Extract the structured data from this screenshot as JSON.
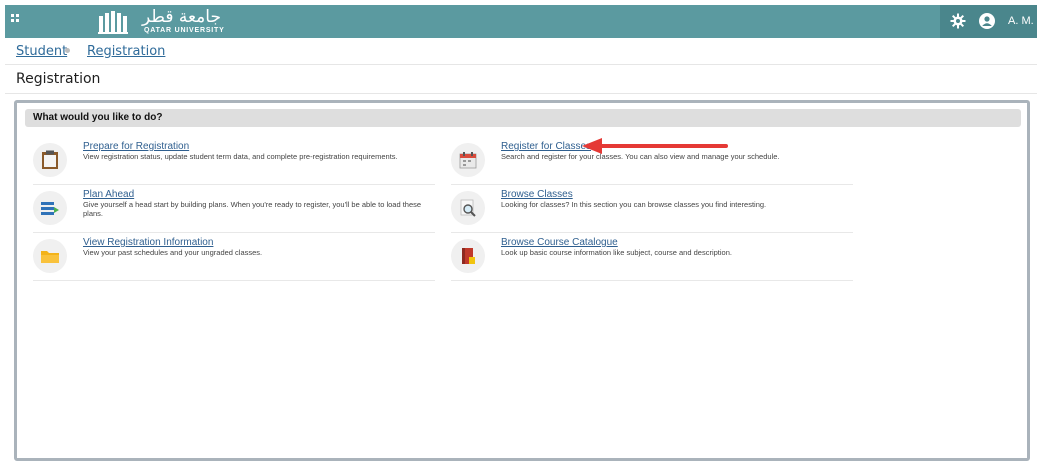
{
  "header": {
    "logo_arabic": "جامعة قطر",
    "logo_english": "QATAR UNIVERSITY",
    "user_name": "A. M."
  },
  "breadcrumb": {
    "items": [
      "Student",
      "Registration"
    ]
  },
  "page": {
    "title": "Registration"
  },
  "panel": {
    "heading": "What would you like to do?",
    "items": [
      {
        "title": "Prepare for Registration",
        "desc": "View registration status, update student term data, and complete pre-registration requirements.",
        "icon": "clipboard-icon"
      },
      {
        "title": "Register for Classes",
        "desc": "Search and register for your classes. You can also view and manage your schedule.",
        "icon": "calendar-icon"
      },
      {
        "title": "Plan Ahead",
        "desc": "Give yourself a head start by building plans. When you're ready to register, you'll be able to load these plans.",
        "icon": "plan-list-icon"
      },
      {
        "title": "Browse Classes",
        "desc": "Looking for classes? In this section you can browse classes you find interesting.",
        "icon": "magnifier-icon"
      },
      {
        "title": "View Registration Information",
        "desc": "View your past schedules and your ungraded classes.",
        "icon": "folder-icon"
      },
      {
        "title": "Browse Course Catalogue",
        "desc": "Look up basic course information like subject, course and description.",
        "icon": "book-icon"
      }
    ]
  },
  "colors": {
    "header": "#5b9aa0",
    "header_dark": "#4a868c",
    "link": "#2f5f8f",
    "arrow": "#e53935"
  }
}
